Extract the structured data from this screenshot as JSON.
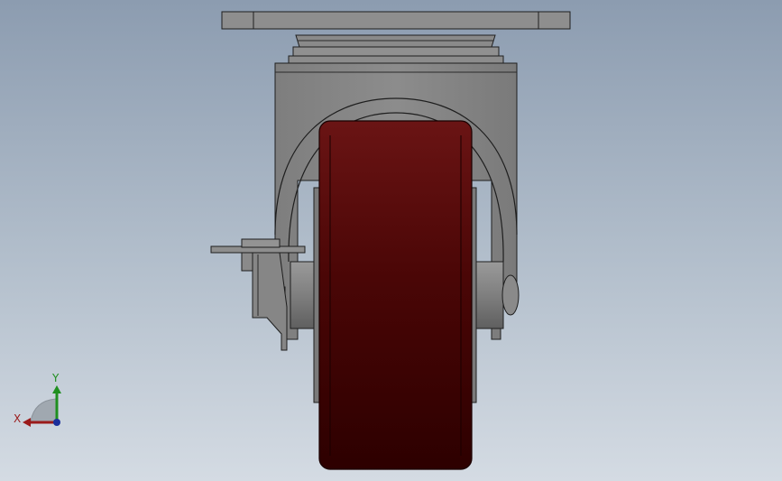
{
  "viewport": {
    "background_top": "#8c9cb0",
    "background_bottom": "#d4dbe3"
  },
  "model": {
    "part": "swivel-caster-with-brake",
    "colors": {
      "metal": "#8a8a8a",
      "metal_dark": "#6e6e6e",
      "metal_light": "#a9a9a9",
      "wheel": "#6a1010",
      "wheel_dark": "#2d0000",
      "edge": "#1e1e1e"
    }
  },
  "triad": {
    "x_label": "X",
    "y_label": "Y",
    "x_color": "#9b1b1b",
    "y_color": "#1f8f1f",
    "z_color": "#1b2f9b"
  }
}
